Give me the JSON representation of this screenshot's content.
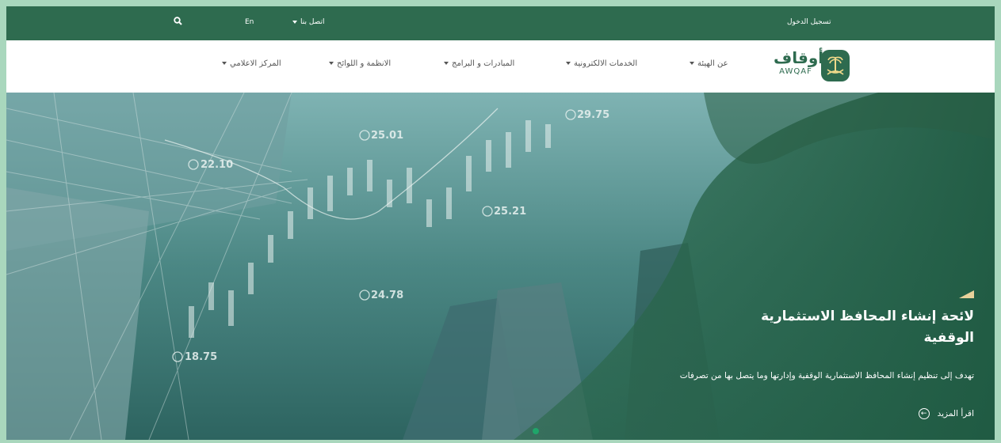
{
  "topbar": {
    "login": "تسجيل الدخول",
    "contact": "اتصل بنا",
    "language": "En",
    "search_icon": "search-icon"
  },
  "logo": {
    "name_ar": "أوقاف",
    "name_en": "AWQAF",
    "emblem_icon": "palm-swords-emblem-icon"
  },
  "nav": {
    "items": [
      {
        "label": "عن الهيئة"
      },
      {
        "label": "الخدمات الالكترونية"
      },
      {
        "label": "المبادرات و البرامج"
      },
      {
        "label": "الانظمة و اللوائح"
      },
      {
        "label": "المركز الاعلامي"
      }
    ]
  },
  "hero": {
    "title": "لائحة إنشاء المحافظ الاستثمارية الوقفية",
    "description": "تهدف إلى تنظيم إنشاء المحافظ الاستثمارية الوقفية وإدارتها وما يتصل بها من تصرفات",
    "read_more": "اقرأ المزيد",
    "chart_labels": [
      "22.10",
      "25.01",
      "29.75",
      "25.21",
      "24.78",
      "18.75"
    ],
    "colors": {
      "primary": "#2e6b4f",
      "accent": "#e8d19b",
      "dot": "#1fa56a"
    }
  }
}
